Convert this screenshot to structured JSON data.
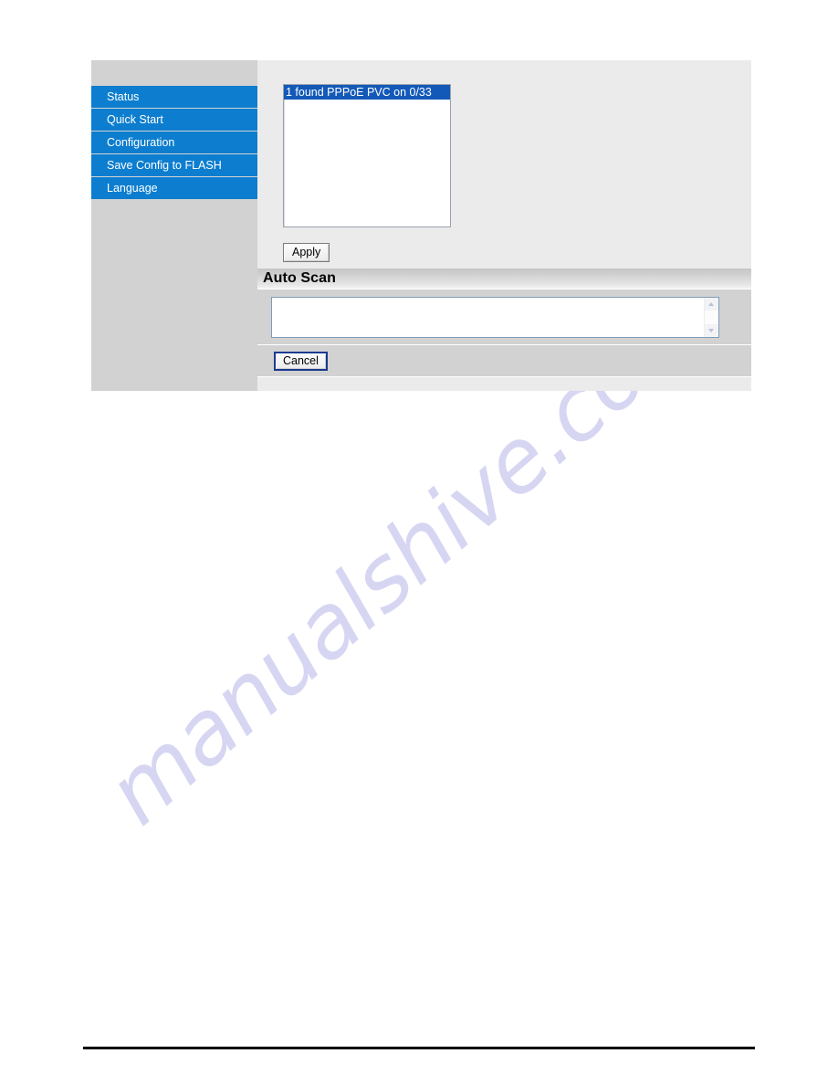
{
  "page": {
    "watermark_text": "manualshive.com",
    "accent_blue": "#0d7ecf",
    "selection_blue": "#1359b8",
    "sidebar_gray": "#d2d2d2",
    "panel_gray": "#ebebeb"
  },
  "sidebar": {
    "items": [
      {
        "label": "Status",
        "name": "status"
      },
      {
        "label": "Quick Start",
        "name": "quick-start"
      },
      {
        "label": "Configuration",
        "name": "configuration"
      },
      {
        "label": "Save Config to FLASH",
        "name": "save-config-to-flash"
      },
      {
        "label": "Language",
        "name": "language"
      }
    ]
  },
  "main": {
    "scan_list": {
      "options": [
        {
          "label": "1 found PPPoE PVC on 0/33",
          "selected": true
        }
      ],
      "selected_value": "1 found PPPoE PVC on 0/33"
    },
    "apply_button": "Apply",
    "section": {
      "title": "Auto Scan"
    },
    "scan_output": {
      "value": "",
      "placeholder": ""
    },
    "cancel_button": "Cancel",
    "scrollbar": {
      "up_icon": "chevron-up-icon",
      "down_icon": "chevron-down-icon"
    }
  }
}
